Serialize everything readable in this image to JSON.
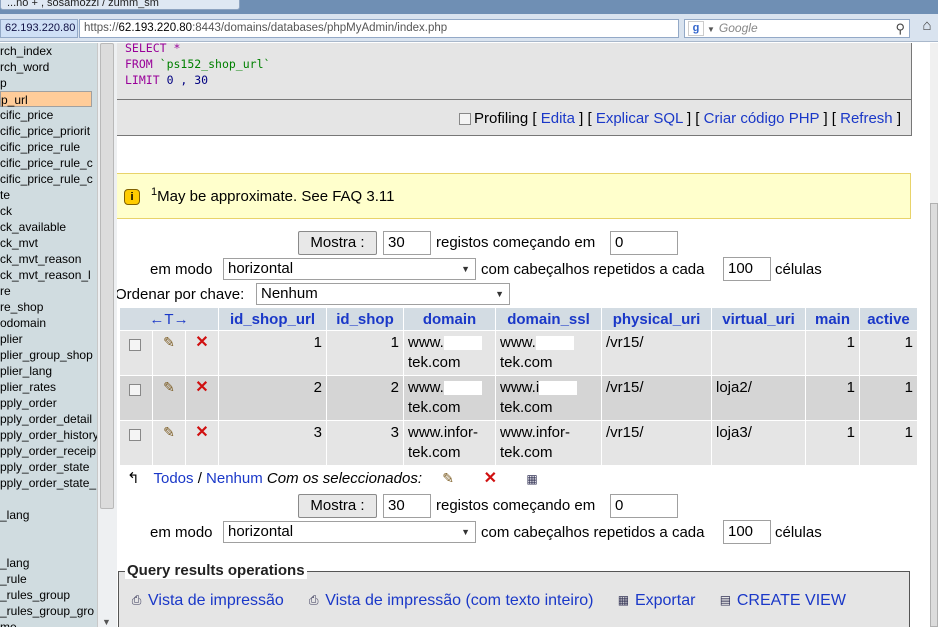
{
  "browser": {
    "tab_title": "...no + , sosamozzi / zumm_sm",
    "ip_badge": "62.193.220.80",
    "url_prefix": "https://",
    "url_host": "62.193.220.80",
    "url_rest": ":8443/domains/databases/phpMyAdmin/index.php",
    "search_placeholder": "Google",
    "search_logo": "g"
  },
  "sidebar": {
    "items": [
      {
        "label": "rch_index"
      },
      {
        "label": "rch_word"
      },
      {
        "label": "p"
      },
      {
        "label": "p_url",
        "selected": true
      },
      {
        "label": "cific_price"
      },
      {
        "label": "cific_price_priorit"
      },
      {
        "label": "cific_price_rule"
      },
      {
        "label": "cific_price_rule_c"
      },
      {
        "label": "cific_price_rule_c"
      },
      {
        "label": "te"
      },
      {
        "label": "ck"
      },
      {
        "label": "ck_available"
      },
      {
        "label": "ck_mvt"
      },
      {
        "label": "ck_mvt_reason"
      },
      {
        "label": "ck_mvt_reason_l"
      },
      {
        "label": "re"
      },
      {
        "label": "re_shop"
      },
      {
        "label": "odomain"
      },
      {
        "label": "plier"
      },
      {
        "label": "plier_group_shop"
      },
      {
        "label": "plier_lang"
      },
      {
        "label": "plier_rates"
      },
      {
        "label": "pply_order"
      },
      {
        "label": "pply_order_detail"
      },
      {
        "label": "pply_order_history"
      },
      {
        "label": "pply_order_receip"
      },
      {
        "label": "pply_order_state"
      },
      {
        "label": "pply_order_state_"
      },
      {
        "label": ""
      },
      {
        "label": "_lang"
      },
      {
        "label": ""
      },
      {
        "label": ""
      },
      {
        "label": "_lang"
      },
      {
        "label": "_rule"
      },
      {
        "label": "_rules_group"
      },
      {
        "label": "_rules_group_gro"
      },
      {
        "label": "me"
      }
    ]
  },
  "sql": {
    "line1_kw": "SELECT *",
    "line2_kw": "FROM",
    "line2_str": "`ps152_shop_url`",
    "line3_kw": "LIMIT",
    "line3_num": "0 , 30"
  },
  "toolbar": {
    "profiling": "Profiling",
    "open": "[",
    "close": "]",
    "sep": "] [",
    "edit": "Edita",
    "explain": "Explicar SQL",
    "create_php": "Criar código PHP",
    "refresh": "Refresh"
  },
  "notice": {
    "icon": "i",
    "sup": "1",
    "text": "May be approximate. See FAQ 3.11"
  },
  "nav_top": {
    "show_button": "Mostra :",
    "rows_value": "30",
    "rows_label": "registos começando em",
    "start_value": "0",
    "mode_label": "em modo",
    "mode_value": "horizontal",
    "headers_label": "com cabeçalhos repetidos a cada",
    "headers_value": "100",
    "cells_label": "células"
  },
  "sort": {
    "label": "Ordenar por chave:",
    "value": "Nenhum"
  },
  "table": {
    "arrows": "←T→",
    "columns": [
      "id_shop_url",
      "id_shop",
      "domain",
      "domain_ssl",
      "physical_uri",
      "virtual_uri",
      "main",
      "active"
    ],
    "rows": [
      {
        "id_shop_url": "1",
        "id_shop": "1",
        "domain_a": "www.",
        "domain_b": "tek.com",
        "ssl_a": "www.",
        "ssl_b": "tek.com",
        "physical_uri": "/vr15/",
        "virtual_uri": "",
        "main": "1",
        "active": "1"
      },
      {
        "id_shop_url": "2",
        "id_shop": "2",
        "domain_a": "www.",
        "domain_b": "tek.com",
        "ssl_a": "www.i",
        "ssl_b": "tek.com",
        "physical_uri": "/vr15/",
        "virtual_uri": "loja2/",
        "main": "1",
        "active": "1"
      },
      {
        "id_shop_url": "3",
        "id_shop": "3",
        "domain_a": "www.infor-",
        "domain_b": "tek.com",
        "ssl_a": "www.infor-",
        "ssl_b": "tek.com",
        "physical_uri": "/vr15/",
        "virtual_uri": "loja3/",
        "main": "1",
        "active": "1"
      }
    ]
  },
  "with_selected": {
    "all": "Todos",
    "slash": "/",
    "none": "Nenhum",
    "label": "Com os seleccionados:"
  },
  "nav_bottom": {
    "show_button": "Mostra :",
    "rows_value": "30",
    "rows_label": "registos começando em",
    "start_value": "0",
    "mode_label": "em modo",
    "mode_value": "horizontal",
    "headers_label": "com cabeçalhos repetidos a cada",
    "headers_value": "100",
    "cells_label": "células"
  },
  "operations": {
    "legend": "Query results operations",
    "print_view": "Vista de impressão",
    "print_view_full": "Vista de impressão (com texto inteiro)",
    "export": "Exportar",
    "create_view": "CREATE VIEW"
  }
}
